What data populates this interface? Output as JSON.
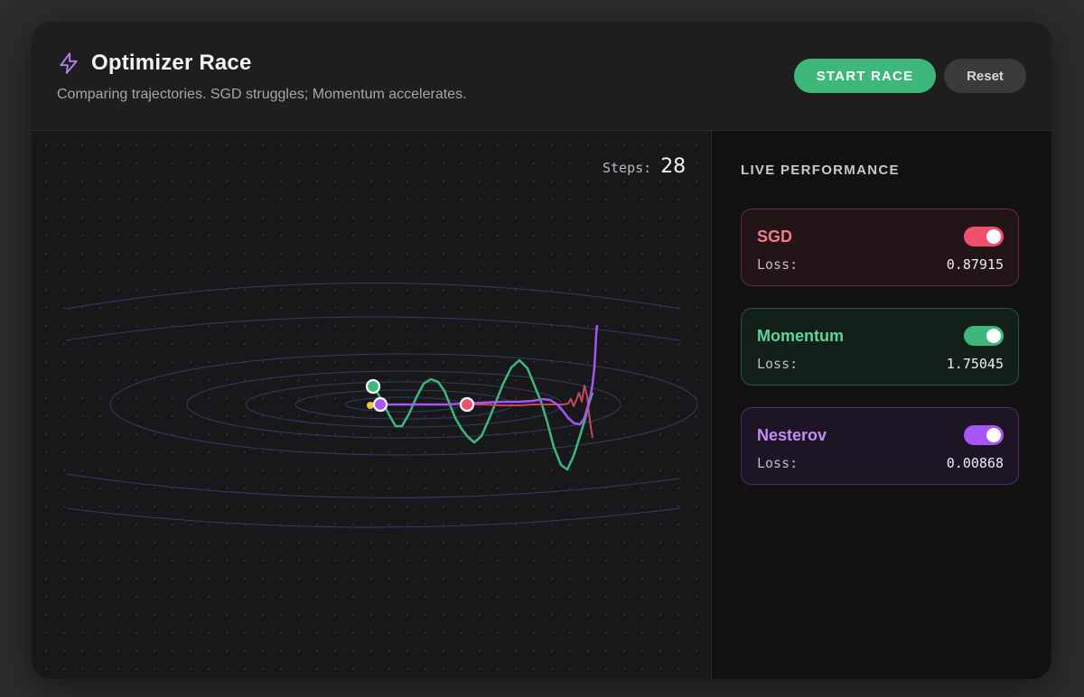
{
  "header": {
    "title": "Optimizer Race",
    "subtitle": "Comparing trajectories. SGD struggles; Momentum accelerates.",
    "icon": "lightning-bolt-icon",
    "start_label": "START RACE",
    "reset_label": "Reset"
  },
  "canvas": {
    "steps_label": "Steps:",
    "steps_value": "28"
  },
  "sidebar": {
    "title": "LIVE PERFORMANCE",
    "optimizers": [
      {
        "name": "SGD",
        "loss_label": "Loss:",
        "loss_value": "0.87915",
        "enabled": true,
        "color": "#f0506e"
      },
      {
        "name": "Momentum",
        "loss_label": "Loss:",
        "loss_value": "1.75045",
        "enabled": true,
        "color": "#3db87a"
      },
      {
        "name": "Nesterov",
        "loss_label": "Loss:",
        "loss_value": "0.00868",
        "enabled": true,
        "color": "#a855f7"
      }
    ]
  },
  "colors": {
    "accent": "#3db87a",
    "sgd": "#f0506e",
    "momentum": "#3db87a",
    "nesterov": "#a855f7",
    "contour": "#2b3f63",
    "target": "#f5c542"
  }
}
